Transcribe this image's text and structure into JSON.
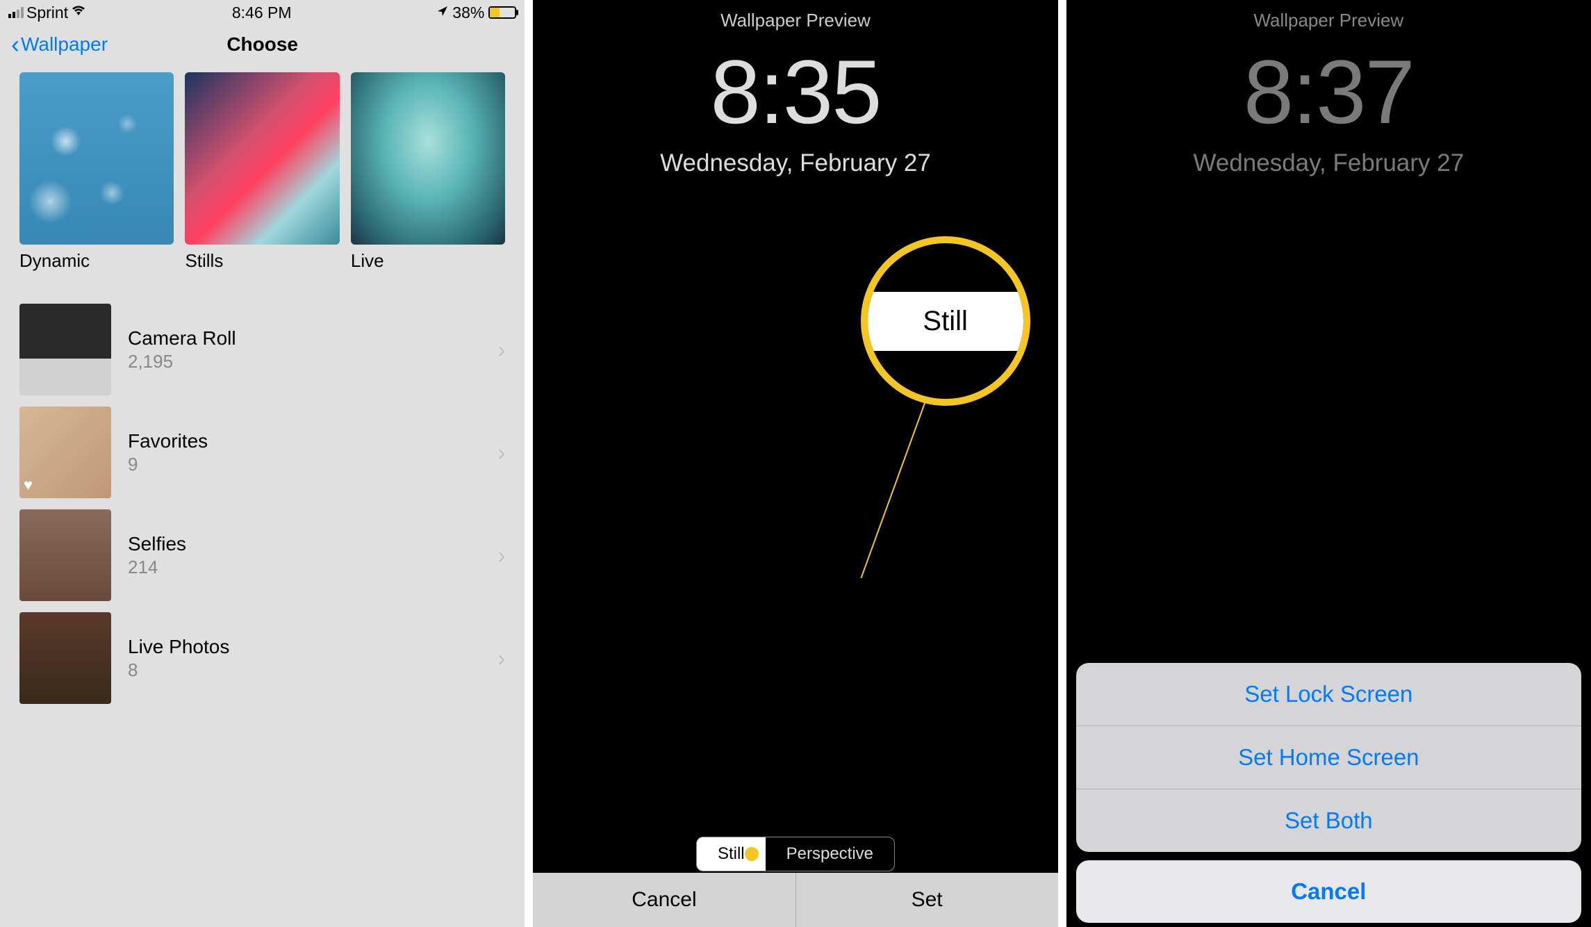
{
  "screen1": {
    "status": {
      "carrier": "Sprint",
      "time": "8:46 PM",
      "battery_pct": "38%"
    },
    "nav": {
      "back_label": "Wallpaper",
      "title": "Choose"
    },
    "categories": [
      {
        "label": "Dynamic"
      },
      {
        "label": "Stills"
      },
      {
        "label": "Live"
      }
    ],
    "albums": [
      {
        "title": "Camera Roll",
        "count": "2,195"
      },
      {
        "title": "Favorites",
        "count": "9"
      },
      {
        "title": "Selfies",
        "count": "214"
      },
      {
        "title": "Live Photos",
        "count": "8"
      }
    ]
  },
  "screen2": {
    "header": "Wallpaper Preview",
    "time": "8:35",
    "date": "Wednesday, February 27",
    "toggle": {
      "still": "Still",
      "perspective": "Perspective"
    },
    "magnifier_label": "Still",
    "bottom": {
      "cancel": "Cancel",
      "set": "Set"
    }
  },
  "screen3": {
    "header": "Wallpaper Preview",
    "time": "8:37",
    "date": "Wednesday, February 27",
    "sheet": {
      "lock": "Set Lock Screen",
      "home": "Set Home Screen",
      "both": "Set Both",
      "cancel": "Cancel"
    }
  }
}
